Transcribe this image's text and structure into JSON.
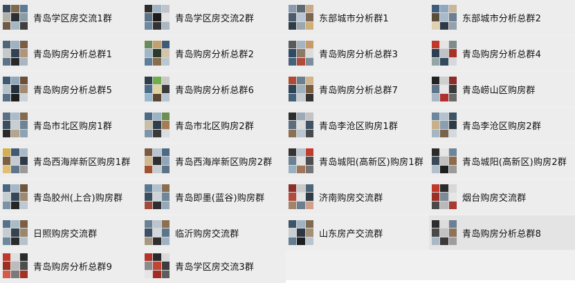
{
  "groups": [
    {
      "id": "r0c0",
      "label": "青岛学区房交流1群",
      "colors": [
        "#3a4b5c",
        "#7f6a4e",
        "#5c7b97",
        "#b3b0a6",
        "#2c2f33",
        "#8c9aa4",
        "#6d5b45",
        "#a4b8c4",
        "#3f3f3f"
      ]
    },
    {
      "id": "r0c1",
      "label": "青岛学区房交流2群",
      "colors": [
        "#2d2d2d",
        "#9eb3c4",
        "#c0c4c8",
        "#5a7387",
        "#1b1b1b",
        "#e4e4e4",
        "#6e8aa0",
        "#333333",
        "#aab7c2"
      ]
    },
    {
      "id": "r0c2",
      "label": "东部城市分析群1",
      "colors": [
        "#8a9bb0",
        "#5d6a74",
        "#c9a98a",
        "#4a5b6b",
        "#b8c7d3",
        "#7a6651",
        "#2f3b45",
        "#9aa7b1",
        "#d0b07a"
      ]
    },
    {
      "id": "r0c3",
      "label": "东部城市分析总群2",
      "colors": [
        "#3f5d7a",
        "#8fa8bf",
        "#c8b79a",
        "#5c4d3b",
        "#a7bacb",
        "#6c7f90",
        "#e0d1b5",
        "#2e3a46",
        "#93a0ad"
      ]
    },
    {
      "id": "r1c0",
      "label": "青岛购房分析总群1",
      "colors": [
        "#4f6578",
        "#9db2c3",
        "#7a5d44",
        "#c6c9cc",
        "#344353",
        "#b0957a",
        "#5d7488",
        "#282828",
        "#a9b6c1"
      ]
    },
    {
      "id": "r1c1",
      "label": "青岛购房分析总群2",
      "colors": [
        "#6b8c5a",
        "#c4a06e",
        "#3d5b78",
        "#9fb6c9",
        "#2b3a2a",
        "#d1c4a8",
        "#5e7e99",
        "#8a6d4c",
        "#b9c7d2"
      ]
    },
    {
      "id": "r1c2",
      "label": "青岛购房分析总群3",
      "colors": [
        "#5a5a5a",
        "#a3b4c2",
        "#c79a6a",
        "#2f4a62",
        "#8d7a66",
        "#dcdcdc",
        "#476178",
        "#b24a3a",
        "#7c8d9b"
      ]
    },
    {
      "id": "r1c3",
      "label": "青岛购房分析总群4",
      "colors": [
        "#c0392b",
        "#e4e4e4",
        "#7f8c8d",
        "#2c3e50",
        "#bdc3c7",
        "#a93226",
        "#95a5a6",
        "#34495e",
        "#d5d8dc"
      ]
    },
    {
      "id": "r2c0",
      "label": "青岛购房分析总群5",
      "colors": [
        "#3c5a73",
        "#8eaac0",
        "#6c4f38",
        "#b5c3cd",
        "#25313c",
        "#a08c72",
        "#577085",
        "#1e1e1e",
        "#cbd3d9"
      ]
    },
    {
      "id": "r2c1",
      "label": "青岛购房分析总群6",
      "colors": [
        "#2f3d4a",
        "#6fae4a",
        "#c9c9c9",
        "#4a6c8a",
        "#e0d3a0",
        "#3a3a3a",
        "#9ab8cd",
        "#5b4636",
        "#b7c5cf"
      ]
    },
    {
      "id": "r2c2",
      "label": "青岛购房分析总群7",
      "colors": [
        "#b04a36",
        "#6c7f8f",
        "#d2b48c",
        "#2e4355",
        "#9fb0bd",
        "#7a5c40",
        "#46627a",
        "#c8ccd0",
        "#333333"
      ]
    },
    {
      "id": "r2c3",
      "label": "青岛崂山区购房群",
      "colors": [
        "#222222",
        "#cfcfcf",
        "#8e2b2b",
        "#5e7589",
        "#e8e8e8",
        "#3a3a3a",
        "#a7b7c4",
        "#b03030",
        "#6a6a6a"
      ]
    },
    {
      "id": "r3c0",
      "label": "青岛市北区购房1群",
      "colors": [
        "#5a7085",
        "#a9bccb",
        "#846a50",
        "#3c4e5e",
        "#c8cfd4",
        "#6f8596",
        "#2a2a2a",
        "#b3a58e",
        "#8ea2b2"
      ]
    },
    {
      "id": "r3c1",
      "label": "青岛市北区购房2群",
      "colors": [
        "#4b6a86",
        "#9cb3c6",
        "#6b8f4e",
        "#c9bfa5",
        "#2f3f4e",
        "#a87c52",
        "#7d95a8",
        "#3b3b3b",
        "#d8dde1"
      ]
    },
    {
      "id": "r3c2",
      "label": "青岛李沧区购房1群",
      "colors": [
        "#2c2c2c",
        "#9aaab6",
        "#c3c3c3",
        "#5b6e7e",
        "#dcdcdc",
        "#3f5266",
        "#8b7055",
        "#b9c6d0",
        "#4a4a4a"
      ]
    },
    {
      "id": "r3c3",
      "label": "青岛李沧区购房2群",
      "colors": [
        "#6e879c",
        "#b2c2ce",
        "#3d5366",
        "#c9b08a",
        "#8a9fb0",
        "#2f3a44",
        "#a5b5c1",
        "#7b634b",
        "#d3d9de"
      ]
    },
    {
      "id": "r4c0",
      "label": "青岛西海岸新区购房1群",
      "colors": [
        "#d8b04a",
        "#3f5a72",
        "#a9bac7",
        "#7d5f42",
        "#c4ccd2",
        "#2e3b47",
        "#e0c070",
        "#5f768a",
        "#9a9a9a"
      ]
    },
    {
      "id": "r4c1",
      "label": "青岛西海岸新区购房2群",
      "colors": [
        "#7b5a44",
        "#b6c5d1",
        "#4e6a82",
        "#d4b78e",
        "#2f2f2f",
        "#91a6b7",
        "#a3522f",
        "#c8cdd1",
        "#5c7488"
      ]
    },
    {
      "id": "r4c2",
      "label": "青岛城阳(高新区)购房1群",
      "colors": [
        "#333333",
        "#b8c3cc",
        "#c23b2e",
        "#6b8296",
        "#e2e2e2",
        "#4d4d4d",
        "#9ab0c1",
        "#a0765a",
        "#757575"
      ]
    },
    {
      "id": "r4c3",
      "label": "青岛城阳(高新区)购房2群",
      "colors": [
        "#2b2b2b",
        "#e6e6e6",
        "#6d8598",
        "#3a4a58",
        "#c0c0c0",
        "#8f6b4d",
        "#b2c0cb",
        "#1f1f1f",
        "#9a9a9a"
      ]
    },
    {
      "id": "r5c0",
      "label": "青岛胶州(上合)购房群",
      "colors": [
        "#4a6580",
        "#a5b9c9",
        "#6e553e",
        "#c6ced4",
        "#35475a",
        "#9d8a70",
        "#7c93a6",
        "#262626",
        "#bfc9d1"
      ]
    },
    {
      "id": "r5c1",
      "label": "青岛即墨(蓝谷)购房群",
      "colors": [
        "#5a7891",
        "#b0c2d0",
        "#8a6c4f",
        "#3b4e60",
        "#ccd4da",
        "#6f879a",
        "#a44a3a",
        "#2e2e2e",
        "#95a9b8"
      ]
    },
    {
      "id": "r5c2",
      "label": "济南购房交流群",
      "colors": [
        "#8c2f2a",
        "#c9c9c9",
        "#4f6477",
        "#b34a3c",
        "#e3e3e3",
        "#2f3b46",
        "#a38468",
        "#6a7f90",
        "#cfa08a"
      ]
    },
    {
      "id": "r5c3",
      "label": "烟台购房交流群",
      "colors": [
        "#c0392b",
        "#2b2b2b",
        "#d8d8d8",
        "#9a3026",
        "#7b8b97",
        "#e6e6e6",
        "#4a4a4a",
        "#b9b9b9",
        "#a83a2f"
      ]
    },
    {
      "id": "r6c0",
      "label": "日照购房交流群",
      "colors": [
        "#56728a",
        "#a8bbc9",
        "#7a5f46",
        "#c5cdd3",
        "#34434f",
        "#9b8770",
        "#6f889b",
        "#2a2a2a",
        "#b4c2cc"
      ]
    },
    {
      "id": "r6c1",
      "label": "临沂购房交流群",
      "colors": [
        "#6b8196",
        "#b9c6d1",
        "#8d6f52",
        "#3e5063",
        "#d1d7dc",
        "#5d7589",
        "#a9987e",
        "#2f2f2f",
        "#9fb2c1"
      ]
    },
    {
      "id": "r6c2",
      "label": "山东房产交流群",
      "colors": [
        "#3c5468",
        "#9fb3c3",
        "#7f6a52",
        "#c8ced3",
        "#2c3844",
        "#a28f75",
        "#647d91",
        "#1f1f1f",
        "#b7c4ce"
      ]
    },
    {
      "id": "r6c3",
      "label": "青岛购房分析总群8",
      "colors": [
        "#2e2e2e",
        "#dcdcdc",
        "#6b8094",
        "#4a4a4a",
        "#c2c2c2",
        "#8e735a",
        "#a9b8c4",
        "#3a3a3a",
        "#9d9d9d"
      ]
    },
    {
      "id": "r7c0",
      "label": "青岛购房分析总群9",
      "colors": [
        "#c0392b",
        "#e0e0e0",
        "#2b2b2b",
        "#9b2f24",
        "#bcbcbc",
        "#4d4d4d",
        "#d45a4a",
        "#7a7a7a",
        "#a33226"
      ]
    },
    {
      "id": "r7c1",
      "label": "青岛学区房交流3群",
      "colors": [
        "#b5342a",
        "#2a2a2a",
        "#dadada",
        "#8c8c8c",
        "#c04535",
        "#3d3d3d",
        "#e5e5e5",
        "#a02e25",
        "#5e5e5e"
      ]
    }
  ]
}
